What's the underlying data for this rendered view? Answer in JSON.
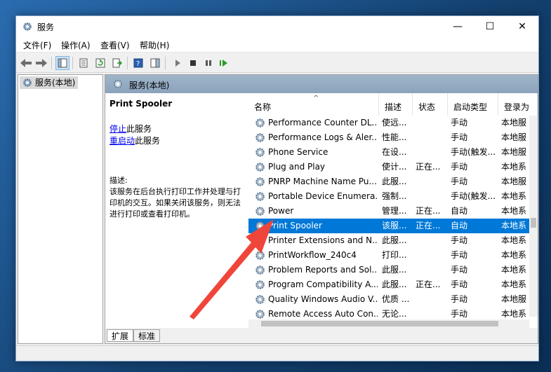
{
  "window": {
    "title": "服务",
    "controls": {
      "minimize": "—",
      "maximize": "☐",
      "close": "✕"
    }
  },
  "menu": [
    {
      "label": "文件(F)"
    },
    {
      "label": "操作(A)"
    },
    {
      "label": "查看(V)"
    },
    {
      "label": "帮助(H)"
    }
  ],
  "toolbar": {
    "icons": [
      "back-icon",
      "forward-icon",
      "show-tree-icon",
      "properties-icon",
      "refresh-icon",
      "export-icon",
      "help-icon",
      "action-pane-icon",
      "start-icon",
      "stop-icon",
      "pause-icon",
      "resume-icon"
    ]
  },
  "tree": {
    "item_label": "服务(本地)"
  },
  "panel": {
    "header": "服务(本地)",
    "service_title": "Print Spooler",
    "stop_link": "停止",
    "stop_suffix": "此服务",
    "restart_link": "重启动",
    "restart_suffix": "此服务",
    "desc_label": "描述:",
    "description": "该服务在后台执行打印工作并处理与打印机的交互。如果关闭该服务，则无法进行打印或查看打印机。"
  },
  "list": {
    "columns": [
      "名称",
      "描述",
      "状态",
      "启动类型",
      "登录为"
    ],
    "rows": [
      {
        "name": "Performance Counter DL...",
        "desc": "使远...",
        "status": "",
        "start": "手动",
        "logon": "本地服"
      },
      {
        "name": "Performance Logs & Aler...",
        "desc": "性能...",
        "status": "",
        "start": "手动",
        "logon": "本地服"
      },
      {
        "name": "Phone Service",
        "desc": "在设...",
        "status": "",
        "start": "手动(触发...",
        "logon": "本地服"
      },
      {
        "name": "Plug and Play",
        "desc": "使计...",
        "status": "正在...",
        "start": "手动",
        "logon": "本地系"
      },
      {
        "name": "PNRP Machine Name Pu...",
        "desc": "此服...",
        "status": "",
        "start": "手动",
        "logon": "本地服"
      },
      {
        "name": "Portable Device Enumera...",
        "desc": "强制...",
        "status": "",
        "start": "手动(触发...",
        "logon": "本地系"
      },
      {
        "name": "Power",
        "desc": "管理...",
        "status": "正在...",
        "start": "自动",
        "logon": "本地系"
      },
      {
        "name": "Print Spooler",
        "desc": "该服...",
        "status": "正在...",
        "start": "自动",
        "logon": "本地系"
      },
      {
        "name": "Printer Extensions and N...",
        "desc": "此服...",
        "status": "",
        "start": "手动",
        "logon": "本地系"
      },
      {
        "name": "PrintWorkflow_240c4",
        "desc": "打印...",
        "status": "",
        "start": "手动",
        "logon": "本地系"
      },
      {
        "name": "Problem Reports and Sol...",
        "desc": "此服...",
        "status": "",
        "start": "手动",
        "logon": "本地系"
      },
      {
        "name": "Program Compatibility A...",
        "desc": "此服...",
        "status": "正在...",
        "start": "手动",
        "logon": "本地系"
      },
      {
        "name": "Quality Windows Audio V...",
        "desc": "优质 ...",
        "status": "",
        "start": "手动",
        "logon": "本地服"
      },
      {
        "name": "Remote Access Auto Con...",
        "desc": "无论...",
        "status": "",
        "start": "手动",
        "logon": "本地系"
      }
    ],
    "selected_index": 7
  },
  "tabs": [
    {
      "label": "扩展"
    },
    {
      "label": "标准"
    }
  ],
  "colors": {
    "selection": "#0078d7",
    "header": "#9fb4c9",
    "arrow": "#f0453a"
  }
}
